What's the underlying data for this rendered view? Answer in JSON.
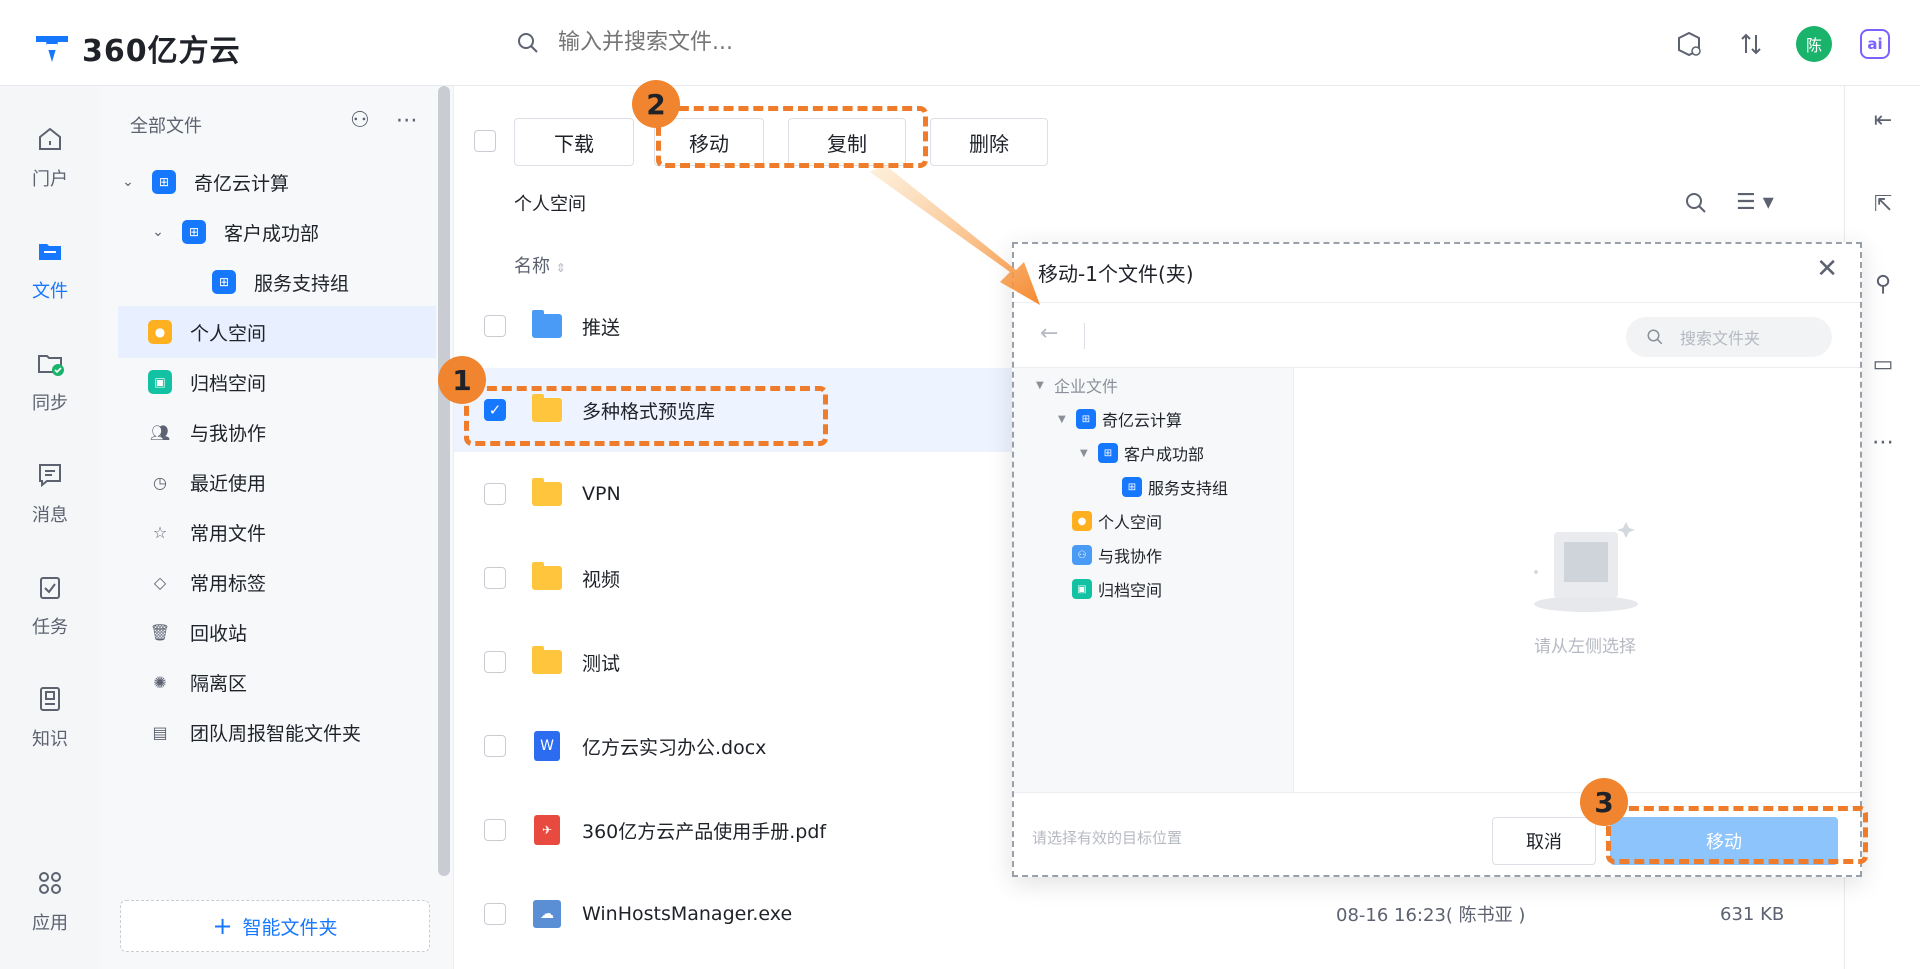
{
  "app": {
    "title": "360亿方云"
  },
  "search": {
    "placeholder": "输入并搜索文件..."
  },
  "user": {
    "avatar_text": "陈"
  },
  "ai_badge": "ai",
  "leftnav": {
    "items": [
      {
        "label": "门户",
        "icon": "portal-icon"
      },
      {
        "label": "文件",
        "icon": "folder-icon"
      },
      {
        "label": "同步",
        "icon": "sync-icon"
      },
      {
        "label": "消息",
        "icon": "message-icon"
      },
      {
        "label": "任务",
        "icon": "task-icon"
      },
      {
        "label": "知识",
        "icon": "knowledge-icon"
      },
      {
        "label": "应用",
        "icon": "apps-icon"
      }
    ]
  },
  "sidebar": {
    "title": "全部文件",
    "items": [
      {
        "label": "奇亿云计算"
      },
      {
        "label": "客户成功部"
      },
      {
        "label": "服务支持组"
      },
      {
        "label": "个人空间"
      },
      {
        "label": "归档空间"
      },
      {
        "label": "与我协作"
      },
      {
        "label": "最近使用"
      },
      {
        "label": "常用文件"
      },
      {
        "label": "常用标签"
      },
      {
        "label": "回收站"
      },
      {
        "label": "隔离区"
      },
      {
        "label": "团队周报智能文件夹"
      }
    ],
    "smart_folder_label": "智能文件夹"
  },
  "toolbar": {
    "download": "下载",
    "move": "移动",
    "copy": "复制",
    "delete": "删除"
  },
  "breadcrumb": "个人空间",
  "column_name": "名称",
  "files": [
    {
      "name": "推送",
      "meta": "",
      "size": ""
    },
    {
      "name": "多种格式预览库",
      "meta": "",
      "size": ""
    },
    {
      "name": "VPN",
      "meta": "",
      "size": ""
    },
    {
      "name": "视频",
      "meta": "",
      "size": ""
    },
    {
      "name": "测试",
      "meta": "",
      "size": ""
    },
    {
      "name": "亿方云实习办公.docx",
      "meta": "",
      "size": ""
    },
    {
      "name": "360亿方云产品使用手册.pdf",
      "meta": "",
      "size": ""
    },
    {
      "name": "WinHostsManager.exe",
      "meta": "08-16 16:23( 陈书亚 )",
      "size": "631 KB"
    }
  ],
  "dialog": {
    "title": "移动-1个文件(夹)",
    "search_placeholder": "搜索文件夹",
    "tree": [
      {
        "label": "企业文件"
      },
      {
        "label": "奇亿云计算"
      },
      {
        "label": "客户成功部"
      },
      {
        "label": "服务支持组"
      },
      {
        "label": "个人空间"
      },
      {
        "label": "与我协作"
      },
      {
        "label": "归档空间"
      }
    ],
    "empty_text": "请从左侧选择",
    "hint": "请选择有效的目标位置",
    "cancel": "取消",
    "confirm": "移动"
  },
  "steps": [
    "1",
    "2",
    "3"
  ],
  "colors": {
    "brand": "#1677ff",
    "highlight": "#ef7c2b",
    "avatar": "#19b36b"
  }
}
